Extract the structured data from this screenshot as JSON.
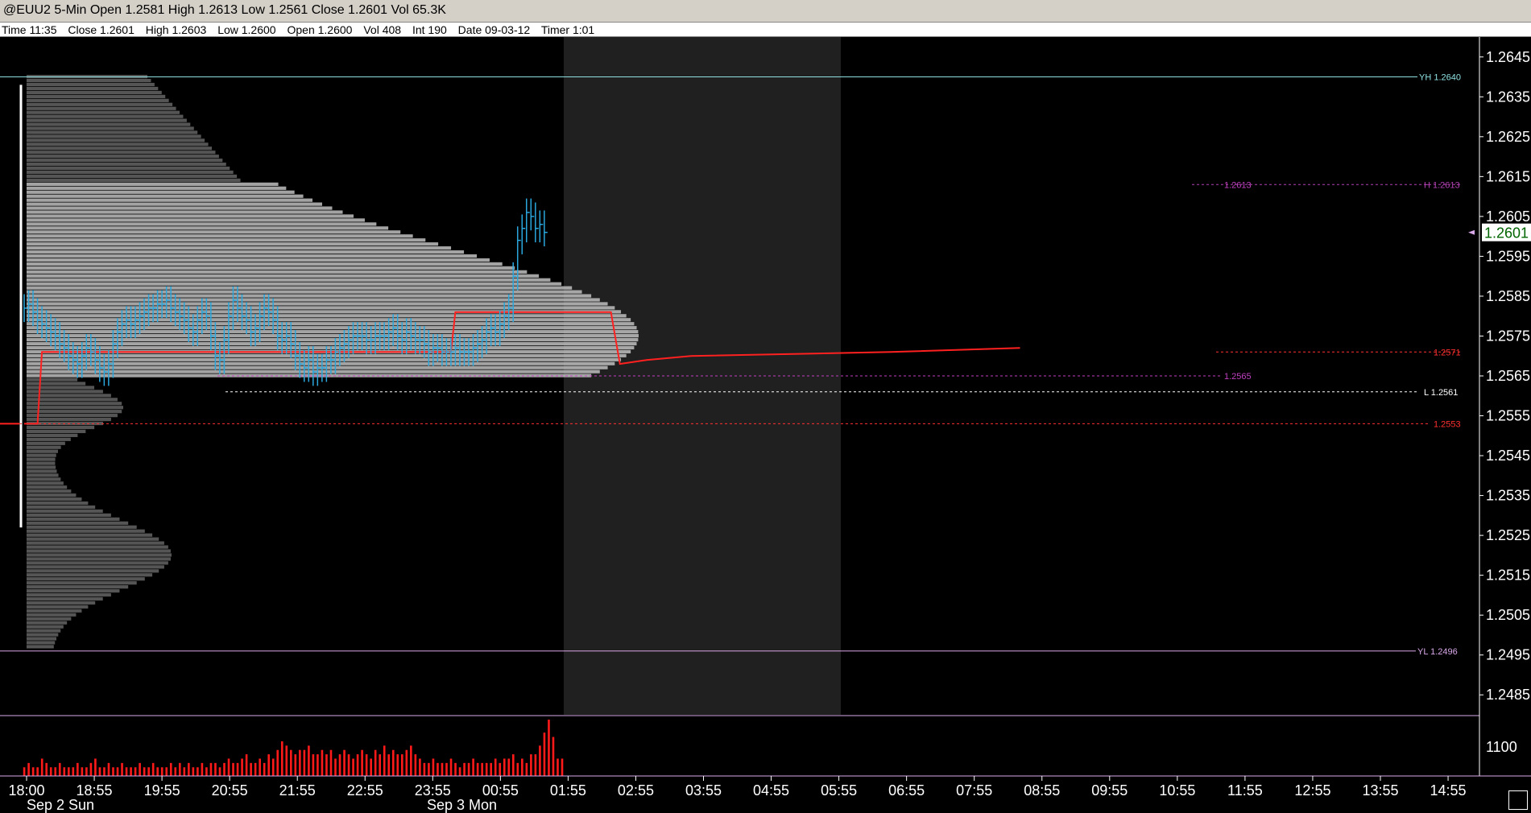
{
  "title": "@EUU2 5-Min Open 1.2581 High 1.2613 Low 1.2561 Close 1.2601 Vol 65.3K",
  "info_fields": [
    "Time 11:35",
    "Close 1.2601",
    "High 1.2603",
    "Low 1.2600",
    "Open 1.2600",
    "Vol 408",
    "Int 190",
    "Date 09-03-12",
    "Timer 1:01"
  ],
  "colors": {
    "price": "#2aa7dd",
    "profile_light": "#c0c0c0",
    "profile_dark": "#6a6a6a",
    "poc": "#ff2020",
    "volume": "#ff1a1a",
    "yh_line": "#8fe0e0",
    "yl_line": "#d8a8e8",
    "magenta": "#c040c0",
    "session_shade": "#202020"
  },
  "chart_data": {
    "type": "line",
    "title": "",
    "symbol": "@EUU2",
    "interval": "5-Min",
    "price_axis": {
      "min": 1.248,
      "max": 1.265,
      "ticks": [
        "1.2645",
        "1.2635",
        "1.2625",
        "1.2615",
        "1.2605",
        "1.2595",
        "1.2585",
        "1.2575",
        "1.2565",
        "1.2555",
        "1.2545",
        "1.2535",
        "1.2525",
        "1.2515",
        "1.2505",
        "1.2495",
        "1.2485"
      ]
    },
    "current_price_label": "1.2601",
    "time_axis": {
      "labels": [
        "18:00",
        "18:55",
        "19:55",
        "20:55",
        "21:55",
        "22:55",
        "23:55",
        "00:55",
        "01:55",
        "02:55",
        "03:55",
        "04:55",
        "05:55",
        "06:55",
        "07:55",
        "08:55",
        "09:55",
        "10:55",
        "11:55",
        "12:55",
        "13:55",
        "14:55"
      ],
      "date_labels": [
        "Sep 2 Sun",
        "Sep 3 Mon"
      ]
    },
    "volume_axis_label": "1100",
    "reference_lines": [
      {
        "label": "YH 1.2640",
        "price": 1.264,
        "color": "#8fe0e0"
      },
      {
        "label": "H 1.2613",
        "price": 1.2613,
        "color": "#b040b0"
      },
      {
        "label": "1.2613",
        "price": 1.2613,
        "color": "#c040c0"
      },
      {
        "label": "1.2571",
        "price": 1.2571,
        "color": "#ff3030"
      },
      {
        "label": "1.2565",
        "price": 1.2565,
        "color": "#c040c0"
      },
      {
        "label": "L 1.2561",
        "price": 1.2561,
        "color": "#ffffff"
      },
      {
        "label": "1.2553",
        "price": 1.2553,
        "color": "#ff3030"
      },
      {
        "label": "YL 1.2496",
        "price": 1.2496,
        "color": "#d8a8e8"
      }
    ],
    "price_series": [
      1.2582,
      1.2583,
      1.2581,
      1.2579,
      1.2578,
      1.2577,
      1.2576,
      1.2575,
      1.2573,
      1.2572,
      1.257,
      1.2569,
      1.2568,
      1.257,
      1.2572,
      1.2571,
      1.2569,
      1.2567,
      1.2566,
      1.2568,
      1.2573,
      1.2576,
      1.2578,
      1.2579,
      1.2578,
      1.2579,
      1.258,
      1.2581,
      1.2582,
      1.2582,
      1.2583,
      1.2583,
      1.2584,
      1.2582,
      1.2581,
      1.258,
      1.2579,
      1.2577,
      1.2576,
      1.2579,
      1.2581,
      1.258,
      1.2575,
      1.257,
      1.2569,
      1.2574,
      1.258,
      1.2584,
      1.2582,
      1.258,
      1.2579,
      1.2576,
      1.2577,
      1.258,
      1.2582,
      1.2581,
      1.2579,
      1.2575,
      1.2574,
      1.2575,
      1.2573,
      1.257,
      1.2568,
      1.2567,
      1.2569,
      1.2566,
      1.2567,
      1.2567,
      1.2569,
      1.2569,
      1.2571,
      1.2572,
      1.2573,
      1.2574,
      1.2575,
      1.2575,
      1.2575,
      1.2574,
      1.2574,
      1.2575,
      1.2575,
      1.2575,
      1.2576,
      1.2577,
      1.2575,
      1.2574,
      1.2576,
      1.2575,
      1.2574,
      1.2574,
      1.2573,
      1.2571,
      1.2572,
      1.2572,
      1.2571,
      1.2571,
      1.2571,
      1.2572,
      1.2571,
      1.2571,
      1.2571,
      1.2572,
      1.2573,
      1.2574,
      1.2576,
      1.2577,
      1.2576,
      1.2578,
      1.258,
      1.2582,
      1.259,
      1.2599,
      1.2602,
      1.2606,
      1.2605,
      1.2602,
      1.2603,
      1.2601
    ],
    "volume_series": [
      2,
      3,
      2,
      2,
      4,
      3,
      2,
      2,
      3,
      2,
      2,
      2,
      3,
      2,
      2,
      3,
      4,
      2,
      2,
      3,
      2,
      2,
      3,
      2,
      2,
      2,
      3,
      2,
      2,
      3,
      2,
      2,
      2,
      3,
      2,
      3,
      2,
      3,
      2,
      2,
      3,
      2,
      3,
      3,
      2,
      3,
      4,
      3,
      3,
      4,
      5,
      3,
      3,
      4,
      3,
      5,
      4,
      6,
      8,
      7,
      6,
      5,
      6,
      6,
      7,
      5,
      5,
      6,
      5,
      6,
      4,
      5,
      6,
      5,
      4,
      5,
      6,
      5,
      4,
      6,
      5,
      7,
      5,
      6,
      5,
      5,
      6,
      7,
      5,
      4,
      3,
      3,
      4,
      3,
      3,
      3,
      4,
      3,
      2,
      3,
      3,
      4,
      3,
      3,
      3,
      3,
      4,
      3,
      4,
      4,
      5,
      3,
      4,
      3,
      5,
      5,
      7,
      10,
      13,
      9,
      4,
      4
    ],
    "poc_path": [
      {
        "t": 0,
        "p": 1.2553
      },
      {
        "t": 3,
        "p": 1.2553
      },
      {
        "t": 4,
        "p": 1.2571
      },
      {
        "t": 96,
        "p": 1.2571
      },
      {
        "t": 97,
        "p": 1.2581
      },
      {
        "t": 132,
        "p": 1.2581
      },
      {
        "t": 134,
        "p": 1.2568
      },
      {
        "t": 140,
        "p": 1.2569
      },
      {
        "t": 150,
        "p": 1.257
      },
      {
        "t": 195,
        "p": 1.2571
      },
      {
        "t": 224,
        "p": 1.2572
      }
    ]
  }
}
